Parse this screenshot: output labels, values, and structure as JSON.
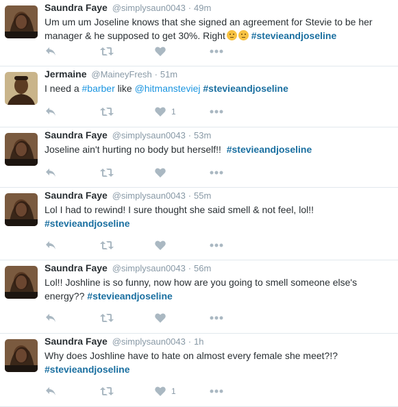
{
  "tweets": [
    {
      "name": "Saundra Faye",
      "handle": "@simplysaun0043",
      "time": "49m",
      "text_before": "Um um um Joseline knows that she signed an agreement for Stevie to be her manager & he supposed to get 30%. Right",
      "hashtag": "#stevieandjoseline",
      "likes": ""
    },
    {
      "name": "Jermaine",
      "handle": "@MaineyFresh",
      "time": "51m",
      "text_before": "I need a ",
      "hashtag_inline": "#barber",
      "text_mid": " like ",
      "mention": "@hitmansteviej",
      "hashtag": "#stevieandjoseline",
      "likes": "1"
    },
    {
      "name": "Saundra Faye",
      "handle": "@simplysaun0043",
      "time": "53m",
      "text_before": "Joseline ain't hurting no body but herself!!  ",
      "hashtag": "#stevieandjoseline",
      "likes": ""
    },
    {
      "name": "Saundra Faye",
      "handle": "@simplysaun0043",
      "time": "55m",
      "text_before": "Lol I had to rewind! I sure thought she said smell & not feel, lol!!",
      "hashtag": "#stevieandjoseline",
      "likes": ""
    },
    {
      "name": "Saundra Faye",
      "handle": "@simplysaun0043",
      "time": "56m",
      "text_before": "Lol!! Joshline is so funny, now how are you going to smell someone else's energy?? ",
      "hashtag": "#stevieandjoseline",
      "likes": ""
    },
    {
      "name": "Saundra Faye",
      "handle": "@simplysaun0043",
      "time": "1h",
      "text_before": "Why does Joshline have to hate on almost every female she meet?!?",
      "hashtag": "#stevieandjoseline",
      "likes": "1"
    }
  ],
  "separator": "·",
  "icons": [
    "reply-icon",
    "retweet-icon",
    "like-icon",
    "more-icon"
  ]
}
